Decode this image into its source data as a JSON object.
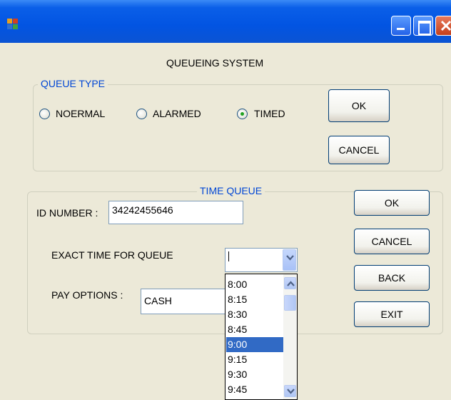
{
  "window": {
    "title": "",
    "heading": "QUEUEING SYSTEM"
  },
  "queue_type": {
    "legend": "QUEUE TYPE",
    "options": [
      {
        "label": "NOERMAL",
        "checked": false
      },
      {
        "label": "ALARMED",
        "checked": false
      },
      {
        "label": "TIMED",
        "checked": true
      }
    ],
    "ok_label": "OK",
    "cancel_label": "CANCEL"
  },
  "time_queue": {
    "legend": "TIME QUEUE",
    "id_label": "ID NUMBER :",
    "id_value": "34242455646",
    "exact_time_label": "EXACT TIME FOR QUEUE",
    "exact_time_value": "",
    "pay_label": "PAY OPTIONS :",
    "pay_value": "CASH",
    "time_options": [
      "8:00",
      "8:15",
      "8:30",
      "8:45",
      "9:00",
      "9:15",
      "9:30",
      "9:45"
    ],
    "selected_time": "9:00",
    "buttons": {
      "ok_label": "OK",
      "cancel_label": "CANCEL",
      "back_label": "BACK",
      "exit_label": "EXIT"
    }
  },
  "icons": {
    "app": "app-icon",
    "minimize": "minimize-icon",
    "maximize": "maximize-icon",
    "close": "close-icon",
    "dropdown": "chevron-down-icon",
    "scroll_up": "chevron-up-icon",
    "scroll_down": "chevron-down-icon"
  },
  "colors": {
    "titlebar": "#0254e2",
    "legend_text": "#0046d5",
    "selection": "#316ac5",
    "radio_dot": "#21a121"
  }
}
